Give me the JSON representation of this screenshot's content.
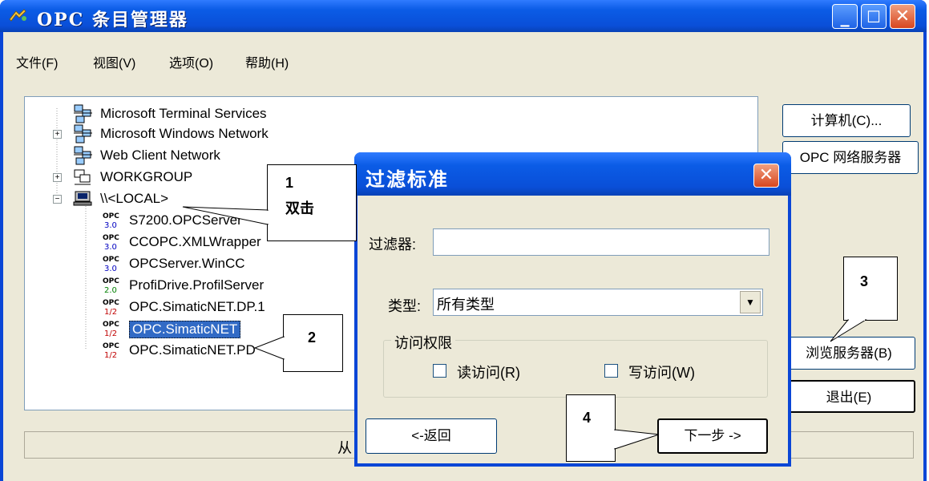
{
  "window": {
    "title": "OPC 条目管理器"
  },
  "menu": [
    {
      "label": "文件(F)"
    },
    {
      "label": "视图(V)"
    },
    {
      "label": "选项(O)"
    },
    {
      "label": "帮助(H)"
    }
  ],
  "tree": {
    "items": [
      {
        "label": "Microsoft Terminal Services",
        "icon": "network-icon"
      },
      {
        "label": "Microsoft Windows Network",
        "icon": "network-icon"
      },
      {
        "label": "Web Client Network",
        "icon": "network-icon"
      },
      {
        "label": "WORKGROUP",
        "icon": "workgroup-icon"
      },
      {
        "label": "\\\\<LOCAL>",
        "icon": "computer-icon"
      },
      {
        "label": "S7200.OPCServer",
        "icon": "opc-icon",
        "ver": "3.0"
      },
      {
        "label": "CCOPC.XMLWrapper",
        "icon": "opc-icon",
        "ver": "3.0"
      },
      {
        "label": "OPCServer.WinCC",
        "icon": "opc-icon",
        "ver": "3.0"
      },
      {
        "label": "ProfiDrive.ProfilServer",
        "icon": "opc-icon",
        "ver": "2.0"
      },
      {
        "label": "OPC.SimaticNET.DP.1",
        "icon": "opc-icon",
        "ver": "1/2"
      },
      {
        "label": "OPC.SimaticNET",
        "icon": "opc-icon",
        "ver": "1/2",
        "selected": true
      },
      {
        "label": "OPC.SimaticNET.PD",
        "icon": "opc-icon",
        "ver": "1/2"
      }
    ]
  },
  "buttons": {
    "computer": "计算机(C)...",
    "opc_network": "OPC 网络服务器",
    "browse": "浏览服务器(B)",
    "exit": "退出(E)"
  },
  "status": {
    "text": "从"
  },
  "dialog": {
    "title": "过滤标准",
    "filter_label": "过滤器:",
    "filter_value": "",
    "type_label": "类型:",
    "type_value": "所有类型",
    "access_group": "访问权限",
    "read_label": "读访问(R)",
    "write_label": "写访问(W)",
    "back_button": "<-返回",
    "next_button": "下一步 ->"
  },
  "callouts": {
    "c1_num": "1",
    "c1_text": "双击",
    "c2": "2",
    "c3": "3",
    "c4": "4"
  },
  "opc_icon_text": "OPC",
  "colors": {
    "titlebar": "#0b5ce6",
    "selection": "#316ac5",
    "face": "#ece9d8"
  }
}
